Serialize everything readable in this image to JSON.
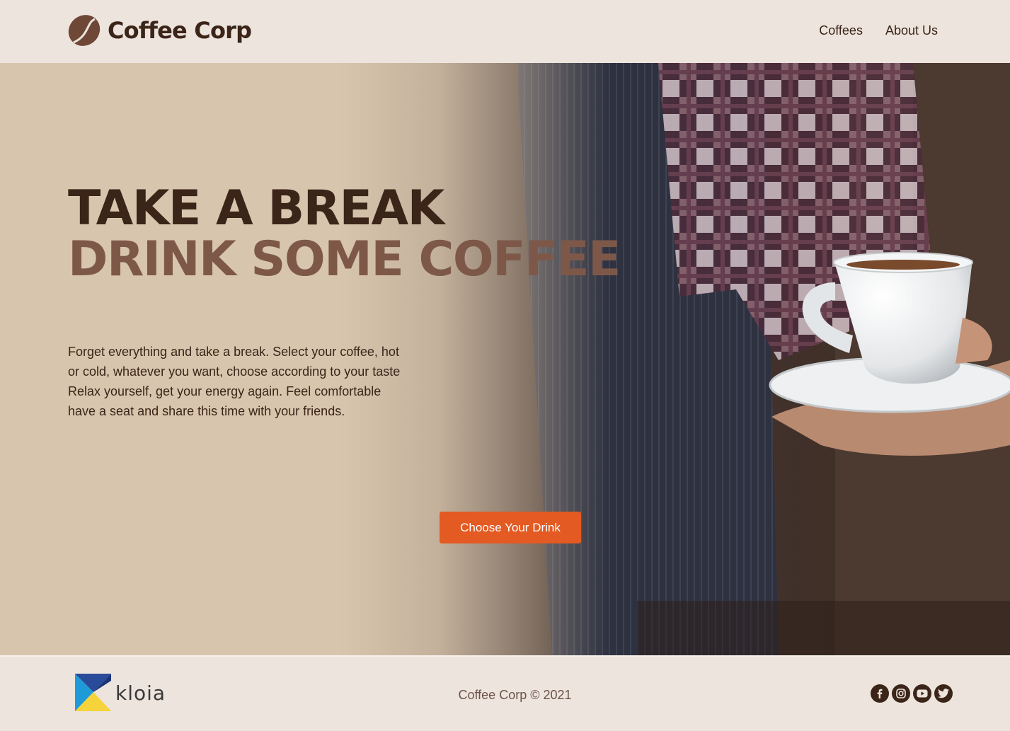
{
  "header": {
    "brand": "Coffee Corp",
    "nav": [
      {
        "label": "Coffees"
      },
      {
        "label": "About Us"
      }
    ]
  },
  "hero": {
    "headline_line1": "TAKE A BREAK",
    "headline_line2": "DRINK SOME COFFEE",
    "body_lines": [
      "Forget everything and take a break. Select your coffee, hot",
      "or cold, whatever you want, choose according to your taste",
      "Relax yourself, get your energy again. Feel comfortable",
      "have a seat and share this time with your friends."
    ],
    "cta_label": "Choose Your Drink"
  },
  "footer": {
    "partner_name": "kloia",
    "copyright": "Coffee Corp © 2021",
    "socials": [
      "facebook-icon",
      "instagram-icon",
      "youtube-icon",
      "twitter-icon"
    ]
  },
  "colors": {
    "dark_brown": "#3b2418",
    "mid_brown": "#7d5848",
    "accent_orange": "#e35a22",
    "beige": "#d8c5ad",
    "cream": "#ede4dd"
  }
}
